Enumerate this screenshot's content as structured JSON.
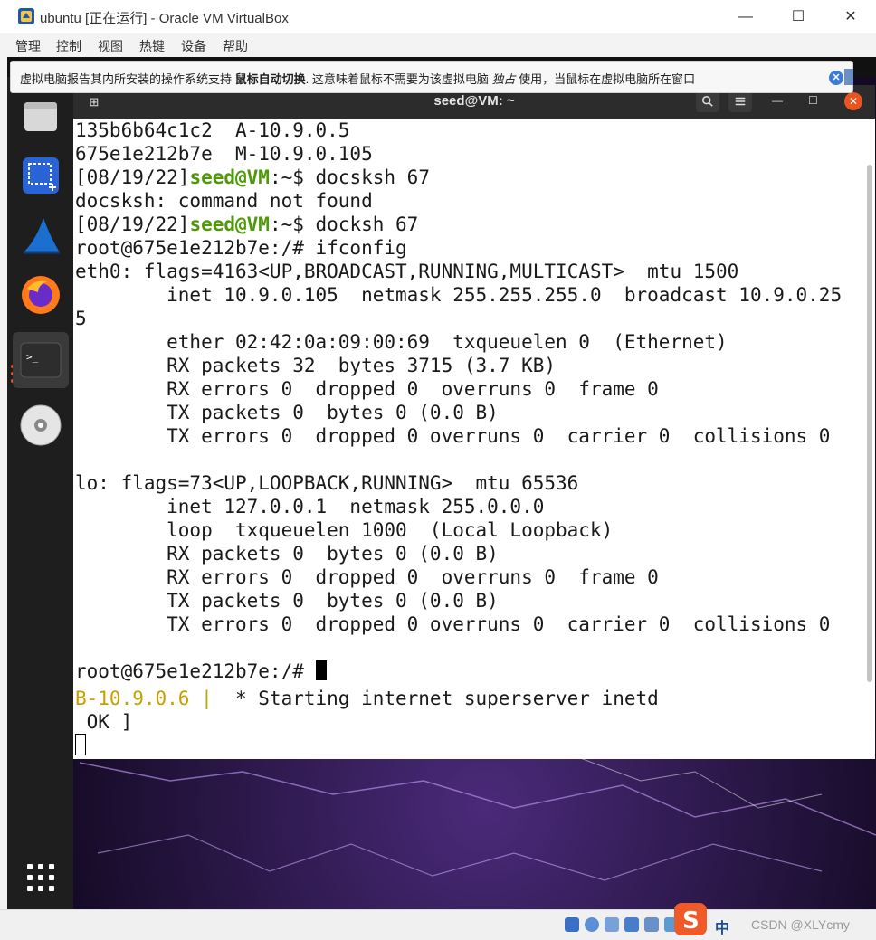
{
  "host_window": {
    "title": "ubuntu [正在运行] - Oracle VM VirtualBox",
    "minimize": "—",
    "maximize": "☐",
    "close": "✕"
  },
  "host_menu": [
    "管理",
    "控制",
    "视图",
    "热键",
    "设备",
    "帮助"
  ],
  "notification": {
    "text_before": "虚拟电脑报告其内所安装的操作系统支持 ",
    "bold_text": "鼠标自动切换",
    "text_middle": ". 这意味着鼠标不需要为该虚拟电脑 ",
    "italic_text": "独占",
    "text_after": " 使用，当鼠标在虚拟电脑所在窗口",
    "close_label": "✕"
  },
  "terminal": {
    "title": "seed@VM: ~",
    "new_tab_icon": "⊞",
    "lines": [
      {
        "text": "135b6b64c1c2  A-10.9.0.5"
      },
      {
        "text": "675e1e212b7e  M-10.9.0.105"
      },
      {
        "prefix": "[08/19/22]",
        "user": "seed@VM",
        "path": ":~$",
        "cmd": " docsksh 67"
      },
      {
        "text": "docsksh: command not found"
      },
      {
        "prefix": "[08/19/22]",
        "user": "seed@VM",
        "path": ":~$",
        "cmd": " docksh 67"
      },
      {
        "text": "root@675e1e212b7e:/# ifconfig"
      },
      {
        "text": "eth0: flags=4163<UP,BROADCAST,RUNNING,MULTICAST>  mtu 1500"
      },
      {
        "text": "        inet 10.9.0.105  netmask 255.255.255.0  broadcast 10.9.0.25"
      },
      {
        "text": "5"
      },
      {
        "text": "        ether 02:42:0a:09:00:69  txqueuelen 0  (Ethernet)"
      },
      {
        "text": "        RX packets 32  bytes 3715 (3.7 KB)"
      },
      {
        "text": "        RX errors 0  dropped 0  overruns 0  frame 0"
      },
      {
        "text": "        TX packets 0  bytes 0 (0.0 B)"
      },
      {
        "text": "        TX errors 0  dropped 0 overruns 0  carrier 0  collisions 0"
      },
      {
        "text": ""
      },
      {
        "text": "lo: flags=73<UP,LOOPBACK,RUNNING>  mtu 65536"
      },
      {
        "text": "        inet 127.0.0.1  netmask 255.0.0.0"
      },
      {
        "text": "        loop  txqueuelen 1000  (Local Loopback)"
      },
      {
        "text": "        RX packets 0  bytes 0 (0.0 B)"
      },
      {
        "text": "        RX errors 0  dropped 0  overruns 0  frame 0"
      },
      {
        "text": "        TX packets 0  bytes 0 (0.0 B)"
      },
      {
        "text": "        TX errors 0  dropped 0 overruns 0  carrier 0  collisions 0"
      },
      {
        "text": ""
      },
      {
        "text": "root@675e1e212b7e:/# "
      }
    ]
  },
  "background_terminal": {
    "host_label": "B-10.9.0.6 |",
    "message": "  * Starting internet superserver inetd                   [",
    "status": " OK ]"
  },
  "taskbar": {
    "ime_label": "中",
    "watermark": "CSDN @XLYcmy"
  },
  "colors": {
    "prompt_green": "#4e9a06",
    "host_yellow": "#c4a000",
    "ubuntu_orange": "#e95420"
  }
}
